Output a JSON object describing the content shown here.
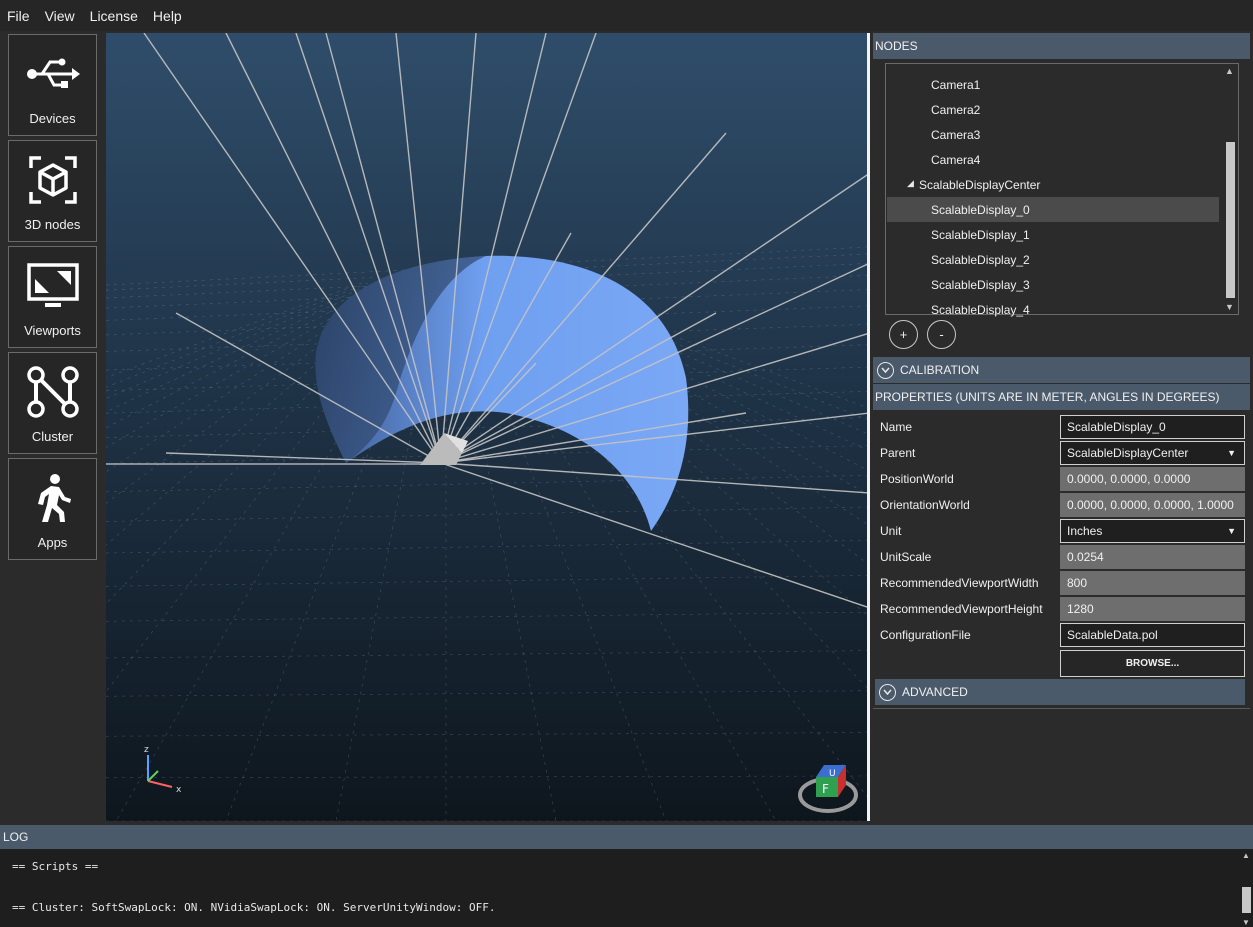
{
  "menu": [
    "File",
    "View",
    "License",
    "Help"
  ],
  "nav": [
    {
      "label": "Devices",
      "icon": "usb-icon"
    },
    {
      "label": "3D nodes",
      "icon": "cube-icon"
    },
    {
      "label": "Viewports",
      "icon": "monitor-icon"
    },
    {
      "label": "Cluster",
      "icon": "network-icon"
    },
    {
      "label": "Apps",
      "icon": "walking-person-icon"
    }
  ],
  "viewport": {
    "axis_labels": {
      "z": "z",
      "x": "x"
    },
    "nav_cube": {
      "top": "U",
      "front": "F"
    }
  },
  "nodes": {
    "header": "NODES",
    "items": [
      {
        "label": "Camera1",
        "indent": 2
      },
      {
        "label": "Camera2",
        "indent": 2
      },
      {
        "label": "Camera3",
        "indent": 2
      },
      {
        "label": "Camera4",
        "indent": 2
      },
      {
        "label": "ScalableDisplayCenter",
        "indent": 1,
        "expanded": true
      },
      {
        "label": "ScalableDisplay_0",
        "indent": 2,
        "selected": true
      },
      {
        "label": "ScalableDisplay_1",
        "indent": 2
      },
      {
        "label": "ScalableDisplay_2",
        "indent": 2
      },
      {
        "label": "ScalableDisplay_3",
        "indent": 2
      },
      {
        "label": "ScalableDisplay_4",
        "indent": 2
      }
    ],
    "add_label": "+",
    "remove_label": "-"
  },
  "calibration": {
    "header": "CALIBRATION"
  },
  "properties": {
    "header": "PROPERTIES (UNITS ARE IN METER, ANGLES IN DEGREES)",
    "rows": [
      {
        "label": "Name",
        "value": "ScalableDisplay_0",
        "kind": "editable"
      },
      {
        "label": "Parent",
        "value": "ScalableDisplayCenter",
        "kind": "dropdown"
      },
      {
        "label": "PositionWorld",
        "value": "0.0000, 0.0000, 0.0000",
        "kind": "readonly"
      },
      {
        "label": "OrientationWorld",
        "value": "0.0000, 0.0000, 0.0000, 1.0000",
        "kind": "readonly"
      },
      {
        "label": "Unit",
        "value": "Inches",
        "kind": "dropdown"
      },
      {
        "label": "UnitScale",
        "value": "0.0254",
        "kind": "readonly"
      },
      {
        "label": "RecommendedViewportWidth",
        "value": "800",
        "kind": "readonly"
      },
      {
        "label": "RecommendedViewportHeight",
        "value": "1280",
        "kind": "readonly"
      },
      {
        "label": "ConfigurationFile",
        "value": "ScalableData.pol",
        "kind": "editable"
      }
    ],
    "browse_label": "BROWSE..."
  },
  "advanced": {
    "header": "ADVANCED"
  },
  "log": {
    "header": "LOG",
    "lines": [
      "== Scripts ==",
      "== Cluster: SoftSwapLock: ON. NVidiaSwapLock: ON. ServerUnityWindow: OFF."
    ]
  },
  "colors": {
    "accent_header": "#4a5a6b",
    "screen_surface": "#6f9ff0",
    "viewport_bg_top": "#2d4a66",
    "viewport_bg_bottom": "#0f1820"
  }
}
